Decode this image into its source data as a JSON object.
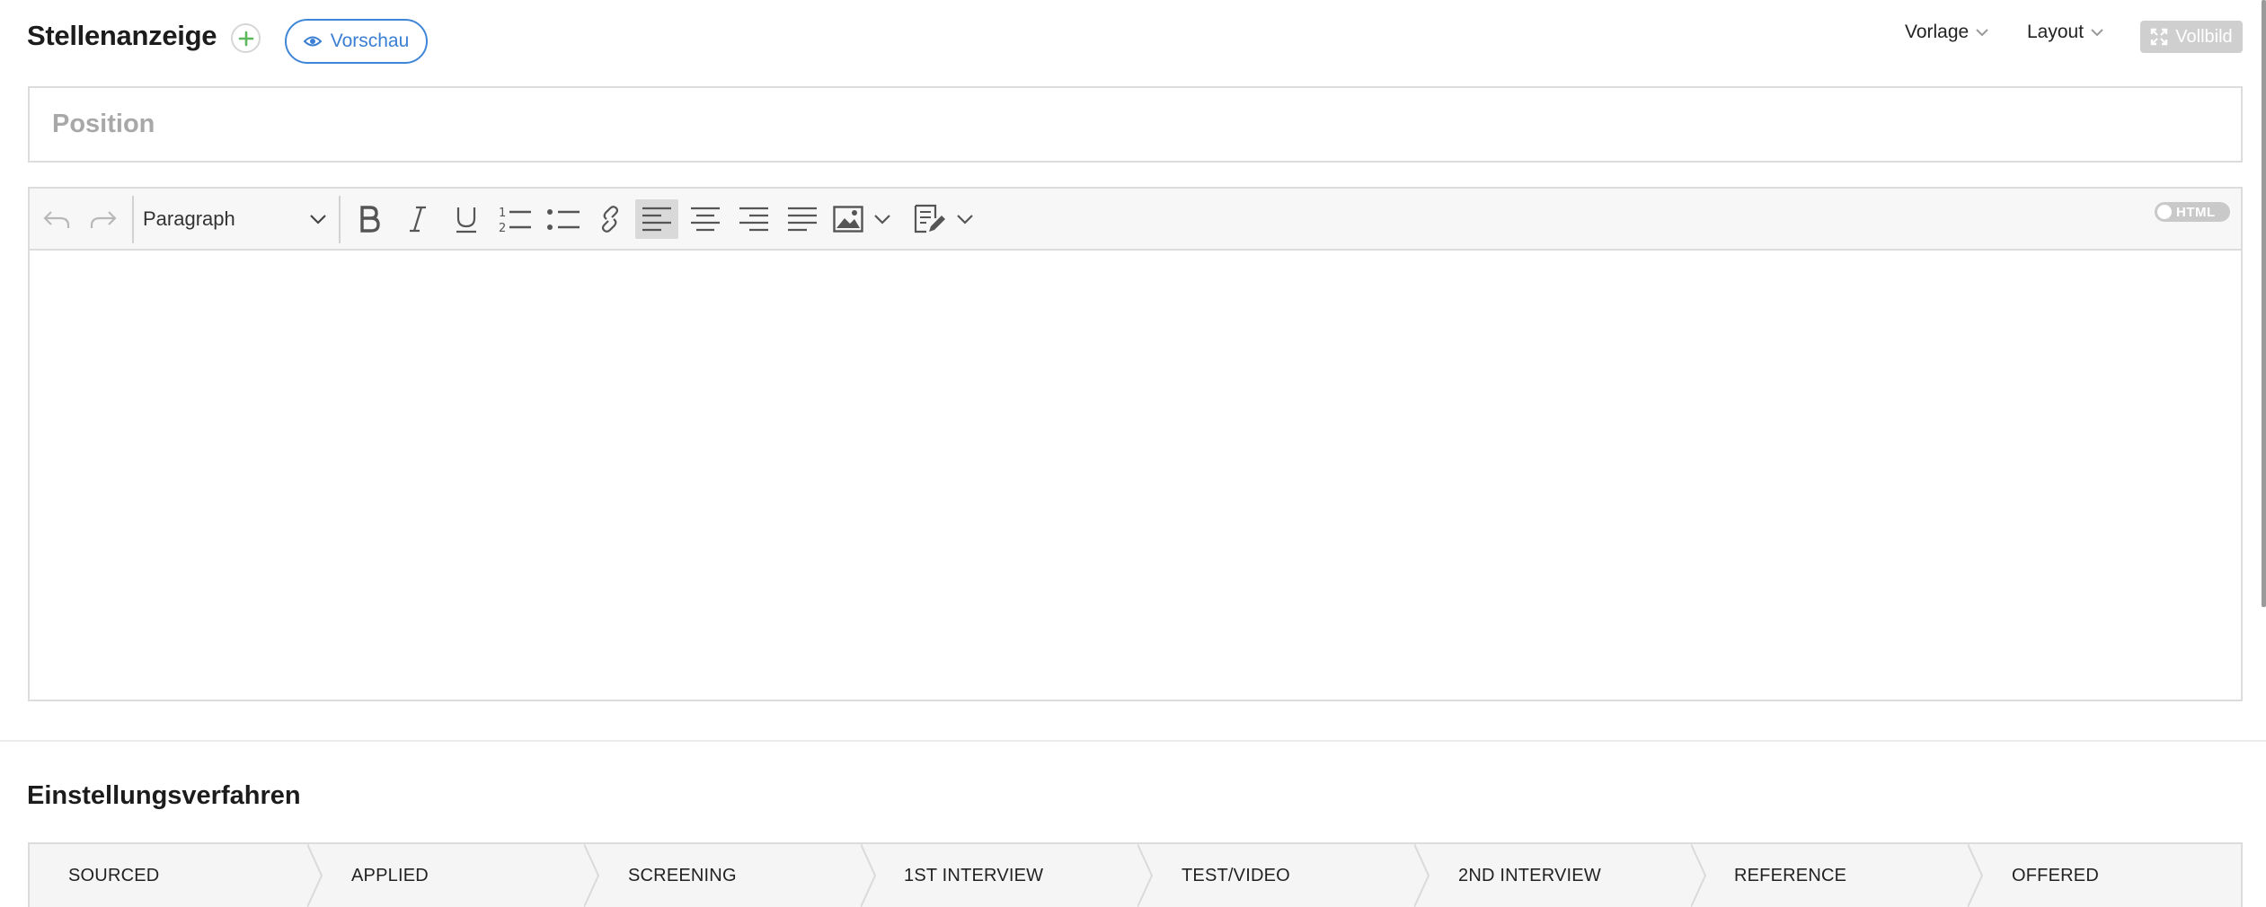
{
  "header": {
    "title": "Stellenanzeige",
    "preview_label": "Vorschau",
    "template_label": "Vorlage",
    "layout_label": "Layout",
    "fullscreen_label": "Vollbild"
  },
  "position": {
    "placeholder": "Position",
    "value": ""
  },
  "editor": {
    "block_format": "Paragraph",
    "html_toggle_label": "HTML",
    "content": ""
  },
  "hiring": {
    "title": "Einstellungsverfahren",
    "stages": [
      "SOURCED",
      "APPLIED",
      "SCREENING",
      "1ST INTERVIEW",
      "TEST/VIDEO",
      "2ND INTERVIEW",
      "REFERENCE",
      "OFFERED"
    ]
  },
  "colors": {
    "accent_blue": "#3f86d8",
    "add_green": "#5cb85c",
    "disabled_gray": "#cfcfcf"
  }
}
